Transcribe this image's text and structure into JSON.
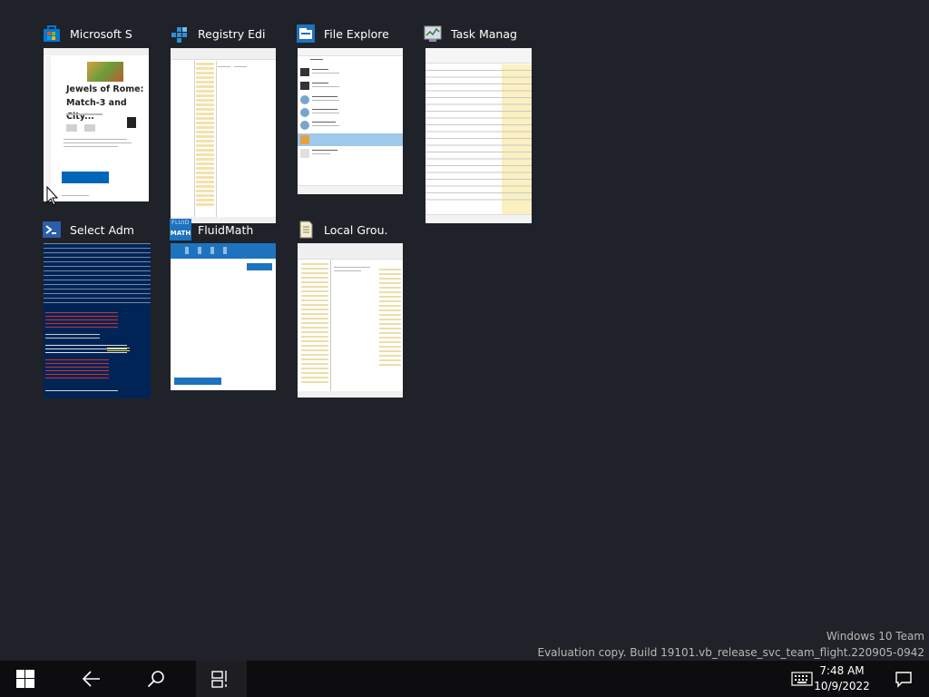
{
  "windows": [
    {
      "title": "Microsoft S",
      "icon": "microsoft-store-icon",
      "thumb_text": {
        "title": "Jewels of Rome: Match-3 and City..."
      }
    },
    {
      "title": "Registry Edi",
      "icon": "registry-editor-icon"
    },
    {
      "title": "File Explore",
      "icon": "file-explorer-icon"
    },
    {
      "title": "Task Manag",
      "icon": "task-manager-icon"
    },
    {
      "title": "Select Adm",
      "icon": "powershell-icon"
    },
    {
      "title": "FluidMath",
      "icon": "fluidmath-icon",
      "thumb_text": {
        "logo_top": "FLUID",
        "logo_bottom": "MATH"
      }
    },
    {
      "title": "Local Grou.",
      "icon": "local-group-policy-icon"
    }
  ],
  "watermark": {
    "line1": "Windows 10 Team",
    "line2": "Evaluation copy. Build 19101.vb_release_svc_team_flight.220905-0942"
  },
  "taskbar": {
    "time": "7:48 AM",
    "date": "10/9/2022",
    "buttons": [
      "start-icon",
      "back-icon",
      "search-icon",
      "task-view-icon",
      "keyboard-icon",
      "notification-icon"
    ]
  },
  "colors": {
    "background": "#1f2228",
    "taskbar": "#0d0d0f",
    "accent": "#1e73be"
  }
}
